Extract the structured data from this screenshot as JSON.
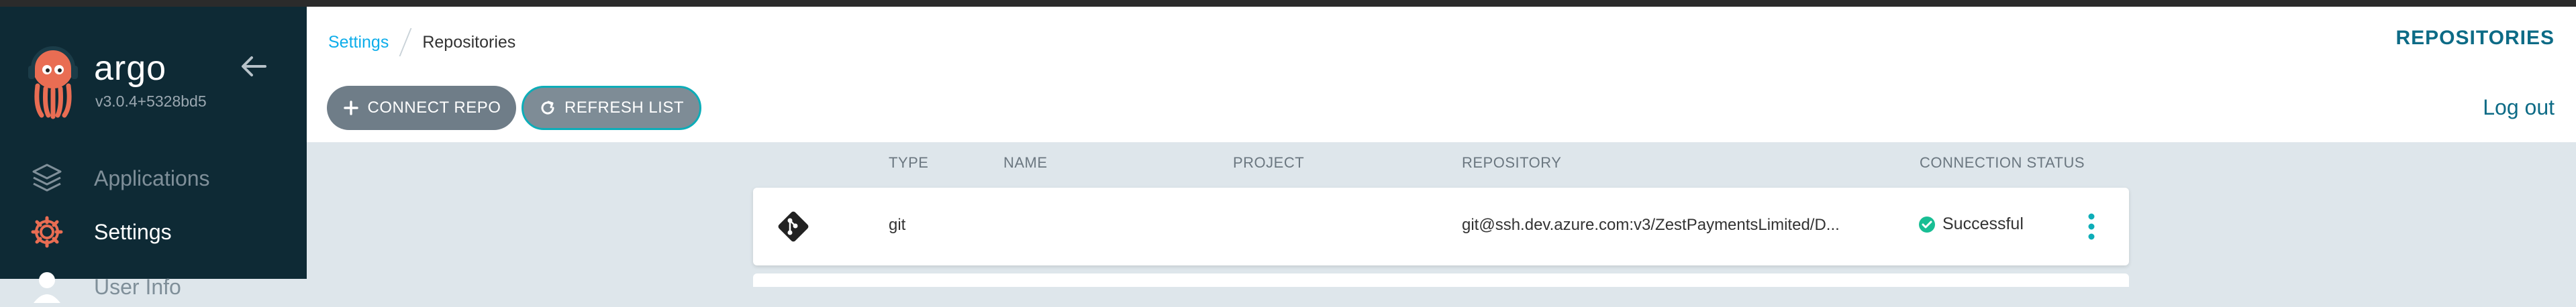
{
  "app": {
    "name": "argo",
    "version": "v3.0.4+5328bd5"
  },
  "sidebar": {
    "items": [
      {
        "label": "Applications",
        "icon": "layers-icon",
        "active": false
      },
      {
        "label": "Settings",
        "icon": "gear-icon",
        "active": true
      },
      {
        "label": "User Info",
        "icon": "user-icon",
        "active": false
      }
    ]
  },
  "breadcrumb": {
    "parent": "Settings",
    "current": "Repositories"
  },
  "header": {
    "title": "REPOSITORIES"
  },
  "toolbar": {
    "connect_label": "CONNECT REPO",
    "refresh_label": "REFRESH LIST",
    "logout_label": "Log out"
  },
  "table": {
    "columns": [
      "TYPE",
      "NAME",
      "PROJECT",
      "REPOSITORY",
      "CONNECTION STATUS"
    ],
    "rows": [
      {
        "type": "git",
        "name": "",
        "project": "",
        "repository": "git@ssh.dev.azure.com:v3/ZestPaymentsLimited/D...",
        "status": "Successful"
      }
    ]
  },
  "colors": {
    "sidebar_bg": "#0e2a35",
    "accent": "#0dadea",
    "title": "#0d6b86",
    "success": "#18be94",
    "button": "#6f7d88"
  }
}
